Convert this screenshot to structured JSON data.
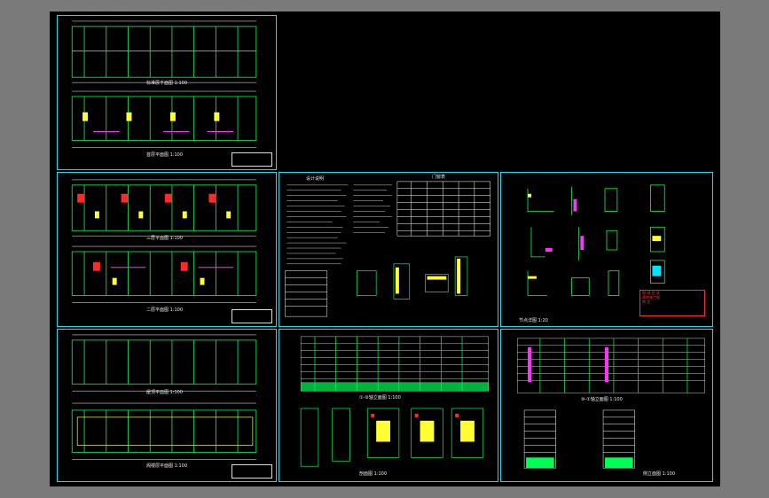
{
  "canvas": {
    "background": "#000000",
    "frame_color": "#00e5ff"
  },
  "colors": {
    "wall": "#00ff55",
    "dim": "#ffffff",
    "accent_magenta": "#ff33ff",
    "accent_yellow": "#ffff33",
    "accent_red": "#ff2a2a",
    "accent_cyan": "#00e5ff"
  },
  "sheets": {
    "plans_1": {
      "labels": [
        "标准层平面图 1:100",
        "首层平面图 1:100"
      ]
    },
    "plans_2": {
      "labels": [
        "三层平面图 1:100",
        "二层平面图 1:100"
      ]
    },
    "plans_3": {
      "labels": [
        "屋顶平面图 1:100",
        "阁楼层平面图 1:100"
      ]
    },
    "notes": {
      "left_heading": "设计说明",
      "right_heading": "门窗表"
    },
    "details": {
      "stamp_line1": "图 纸 目 录",
      "stamp_line2": "建筑施工图",
      "stamp_line3": "审 定",
      "footer": "节点详图 1:20"
    },
    "elevations": {
      "label_front": "①-⑩轴立面图 1:100",
      "label_bottom": "剖面图 1:100"
    },
    "elevations_2": {
      "label_front": "⑩-①轴立面图 1:100",
      "label_bottom": "侧立面图 1:100"
    }
  }
}
